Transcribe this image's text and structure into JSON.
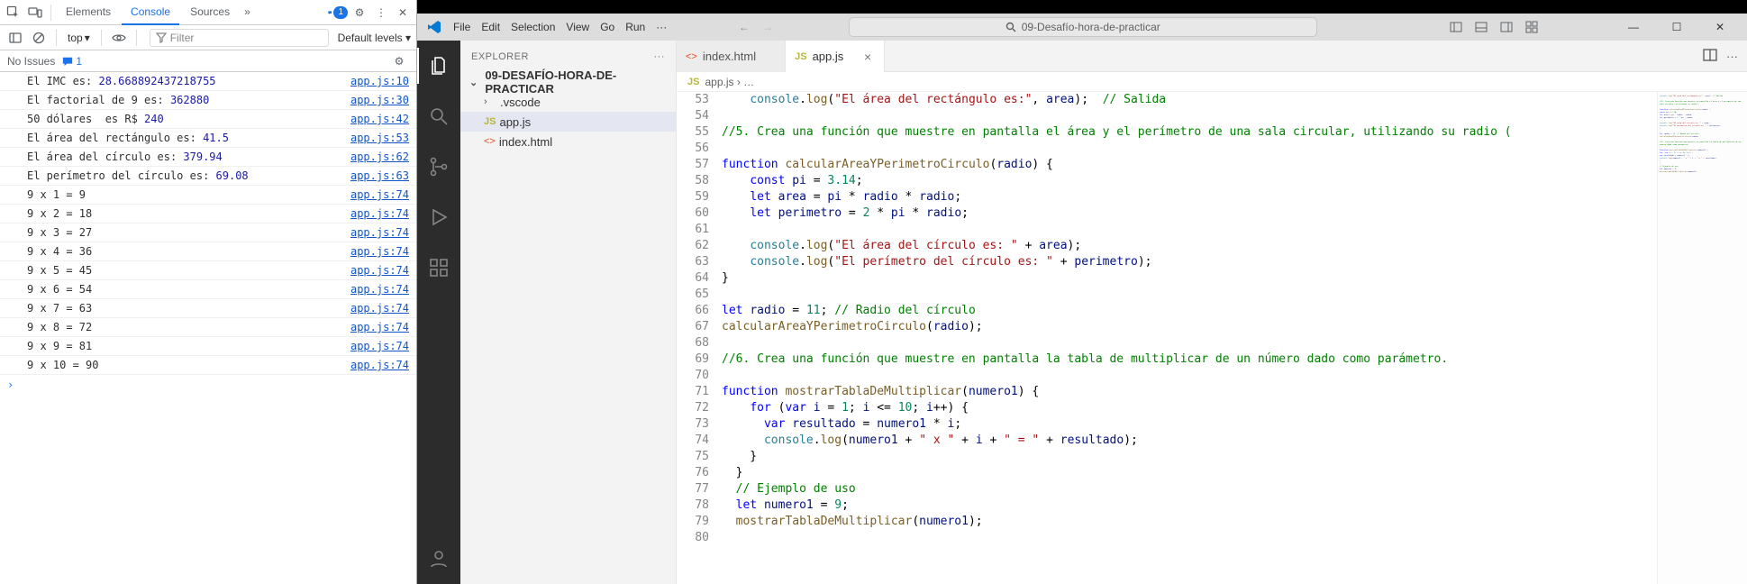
{
  "devtools": {
    "tabs": {
      "elements": "Elements",
      "console": "Console",
      "sources": "Sources",
      "more": "»",
      "msg_badge": "1"
    },
    "toolbar": {
      "context": "top",
      "filter_placeholder": "Filter",
      "levels": "Default levels"
    },
    "issues": {
      "no_issues": "No Issues",
      "badge": "1"
    },
    "rows": [
      {
        "text_pre": "El IMC es: ",
        "num": "28.668892437218755",
        "text_post": "",
        "src": "app.js:10"
      },
      {
        "text_pre": "El factorial de 9 es: ",
        "num": "362880",
        "text_post": "",
        "src": "app.js:30"
      },
      {
        "text_pre": "50 dólares  es R$ ",
        "num": "240",
        "text_post": "",
        "src": "app.js:42"
      },
      {
        "text_pre": "El área del rectángulo es: ",
        "num": "41.5",
        "text_post": "",
        "src": "app.js:53"
      },
      {
        "text_pre": "El área del círculo es: ",
        "num": "379.94",
        "text_post": "",
        "src": "app.js:62"
      },
      {
        "text_pre": "El perímetro del círculo es: ",
        "num": "69.08",
        "text_post": "",
        "src": "app.js:63"
      },
      {
        "text_pre": "9 x 1 = 9",
        "num": "",
        "text_post": "",
        "src": "app.js:74"
      },
      {
        "text_pre": "9 x 2 = 18",
        "num": "",
        "text_post": "",
        "src": "app.js:74"
      },
      {
        "text_pre": "9 x 3 = 27",
        "num": "",
        "text_post": "",
        "src": "app.js:74"
      },
      {
        "text_pre": "9 x 4 = 36",
        "num": "",
        "text_post": "",
        "src": "app.js:74"
      },
      {
        "text_pre": "9 x 5 = 45",
        "num": "",
        "text_post": "",
        "src": "app.js:74"
      },
      {
        "text_pre": "9 x 6 = 54",
        "num": "",
        "text_post": "",
        "src": "app.js:74"
      },
      {
        "text_pre": "9 x 7 = 63",
        "num": "",
        "text_post": "",
        "src": "app.js:74"
      },
      {
        "text_pre": "9 x 8 = 72",
        "num": "",
        "text_post": "",
        "src": "app.js:74"
      },
      {
        "text_pre": "9 x 9 = 81",
        "num": "",
        "text_post": "",
        "src": "app.js:74"
      },
      {
        "text_pre": "9 x 10 = 90",
        "num": "",
        "text_post": "",
        "src": "app.js:74"
      }
    ]
  },
  "vscode": {
    "menu": [
      "File",
      "Edit",
      "Selection",
      "View",
      "Go",
      "Run",
      "···"
    ],
    "omnibox": "09-Desafío-hora-de-practicar",
    "explorer": {
      "title": "EXPLORER",
      "root": "09-DESAFÍO-HORA-DE-PRACTICAR",
      "items": [
        {
          "label": ".vscode",
          "kind": "folder"
        },
        {
          "label": "app.js",
          "kind": "js"
        },
        {
          "label": "index.html",
          "kind": "html"
        }
      ]
    },
    "tabs": {
      "inactive": "index.html",
      "active": "app.js"
    },
    "breadcrumb": "app.js ›  …",
    "lines": [
      {
        "n": 53,
        "html": "    <span class='c-cons'>console</span>.<span class='c-fn'>log</span>(<span class='c-str'>\"El área del rectángulo es:\"</span>, <span class='c-var'>area</span>);  <span class='c-cmt'>// Salida</span>"
      },
      {
        "n": 54,
        "html": ""
      },
      {
        "n": 55,
        "html": "<span class='c-cmt'>//5. Crea una función que muestre en pantalla el área y el perímetro de una sala circular, utilizando su radio (</span>"
      },
      {
        "n": 56,
        "html": ""
      },
      {
        "n": 57,
        "html": "<span class='c-kw'>function</span> <span class='c-fn'>calcularAreaYPerimetroCirculo</span>(<span class='c-var'>radio</span>) {"
      },
      {
        "n": 58,
        "html": "    <span class='c-kw'>const</span> <span class='c-var'>pi</span> = <span class='c-num'>3.14</span>;"
      },
      {
        "n": 59,
        "html": "    <span class='c-kw'>let</span> <span class='c-var'>area</span> = <span class='c-var'>pi</span> * <span class='c-var'>radio</span> * <span class='c-var'>radio</span>;"
      },
      {
        "n": 60,
        "html": "    <span class='c-kw'>let</span> <span class='c-var'>perimetro</span> = <span class='c-num'>2</span> * <span class='c-var'>pi</span> * <span class='c-var'>radio</span>;"
      },
      {
        "n": 61,
        "html": ""
      },
      {
        "n": 62,
        "html": "    <span class='c-cons'>console</span>.<span class='c-fn'>log</span>(<span class='c-str'>\"El área del círculo es: \"</span> + <span class='c-var'>area</span>);"
      },
      {
        "n": 63,
        "html": "    <span class='c-cons'>console</span>.<span class='c-fn'>log</span>(<span class='c-str'>\"El perímetro del círculo es: \"</span> + <span class='c-var'>perimetro</span>);"
      },
      {
        "n": 64,
        "html": "}"
      },
      {
        "n": 65,
        "html": ""
      },
      {
        "n": 66,
        "html": "<span class='c-kw'>let</span> <span class='c-var'>radio</span> = <span class='c-num'>11</span>; <span class='c-cmt'>// Radio del círculo</span>"
      },
      {
        "n": 67,
        "html": "<span class='c-fn'>calcularAreaYPerimetroCirculo</span>(<span class='c-var'>radio</span>);"
      },
      {
        "n": 68,
        "html": ""
      },
      {
        "n": 69,
        "html": "<span class='c-cmt'>//6. Crea una función que muestre en pantalla la tabla de multiplicar de un número dado como parámetro.</span>"
      },
      {
        "n": 70,
        "html": ""
      },
      {
        "n": 71,
        "html": "<span class='c-kw'>function</span> <span class='c-fn'>mostrarTablaDeMultiplicar</span>(<span class='c-var'>numero1</span>) {"
      },
      {
        "n": 72,
        "html": "    <span class='c-kw'>for</span> (<span class='c-kw'>var</span> <span class='c-var'>i</span> = <span class='c-num'>1</span>; <span class='c-var'>i</span> &lt;= <span class='c-num'>10</span>; <span class='c-var'>i</span>++) {"
      },
      {
        "n": 73,
        "html": "      <span class='c-kw'>var</span> <span class='c-var'>resultado</span> = <span class='c-var'>numero1</span> * <span class='c-var'>i</span>;"
      },
      {
        "n": 74,
        "html": "      <span class='c-cons'>console</span>.<span class='c-fn'>log</span>(<span class='c-var'>numero1</span> + <span class='c-str'>\" x \"</span> + <span class='c-var'>i</span> + <span class='c-str'>\" = \"</span> + <span class='c-var'>resultado</span>);"
      },
      {
        "n": 75,
        "html": "    }"
      },
      {
        "n": 76,
        "html": "  }"
      },
      {
        "n": 77,
        "html": "  <span class='c-cmt'>// Ejemplo de uso</span>"
      },
      {
        "n": 78,
        "html": "  <span class='c-kw'>let</span> <span class='c-var'>numero1</span> = <span class='c-num'>9</span>;"
      },
      {
        "n": 79,
        "html": "  <span class='c-fn'>mostrarTablaDeMultiplicar</span>(<span class='c-var'>numero1</span>);"
      },
      {
        "n": 80,
        "html": ""
      }
    ]
  }
}
